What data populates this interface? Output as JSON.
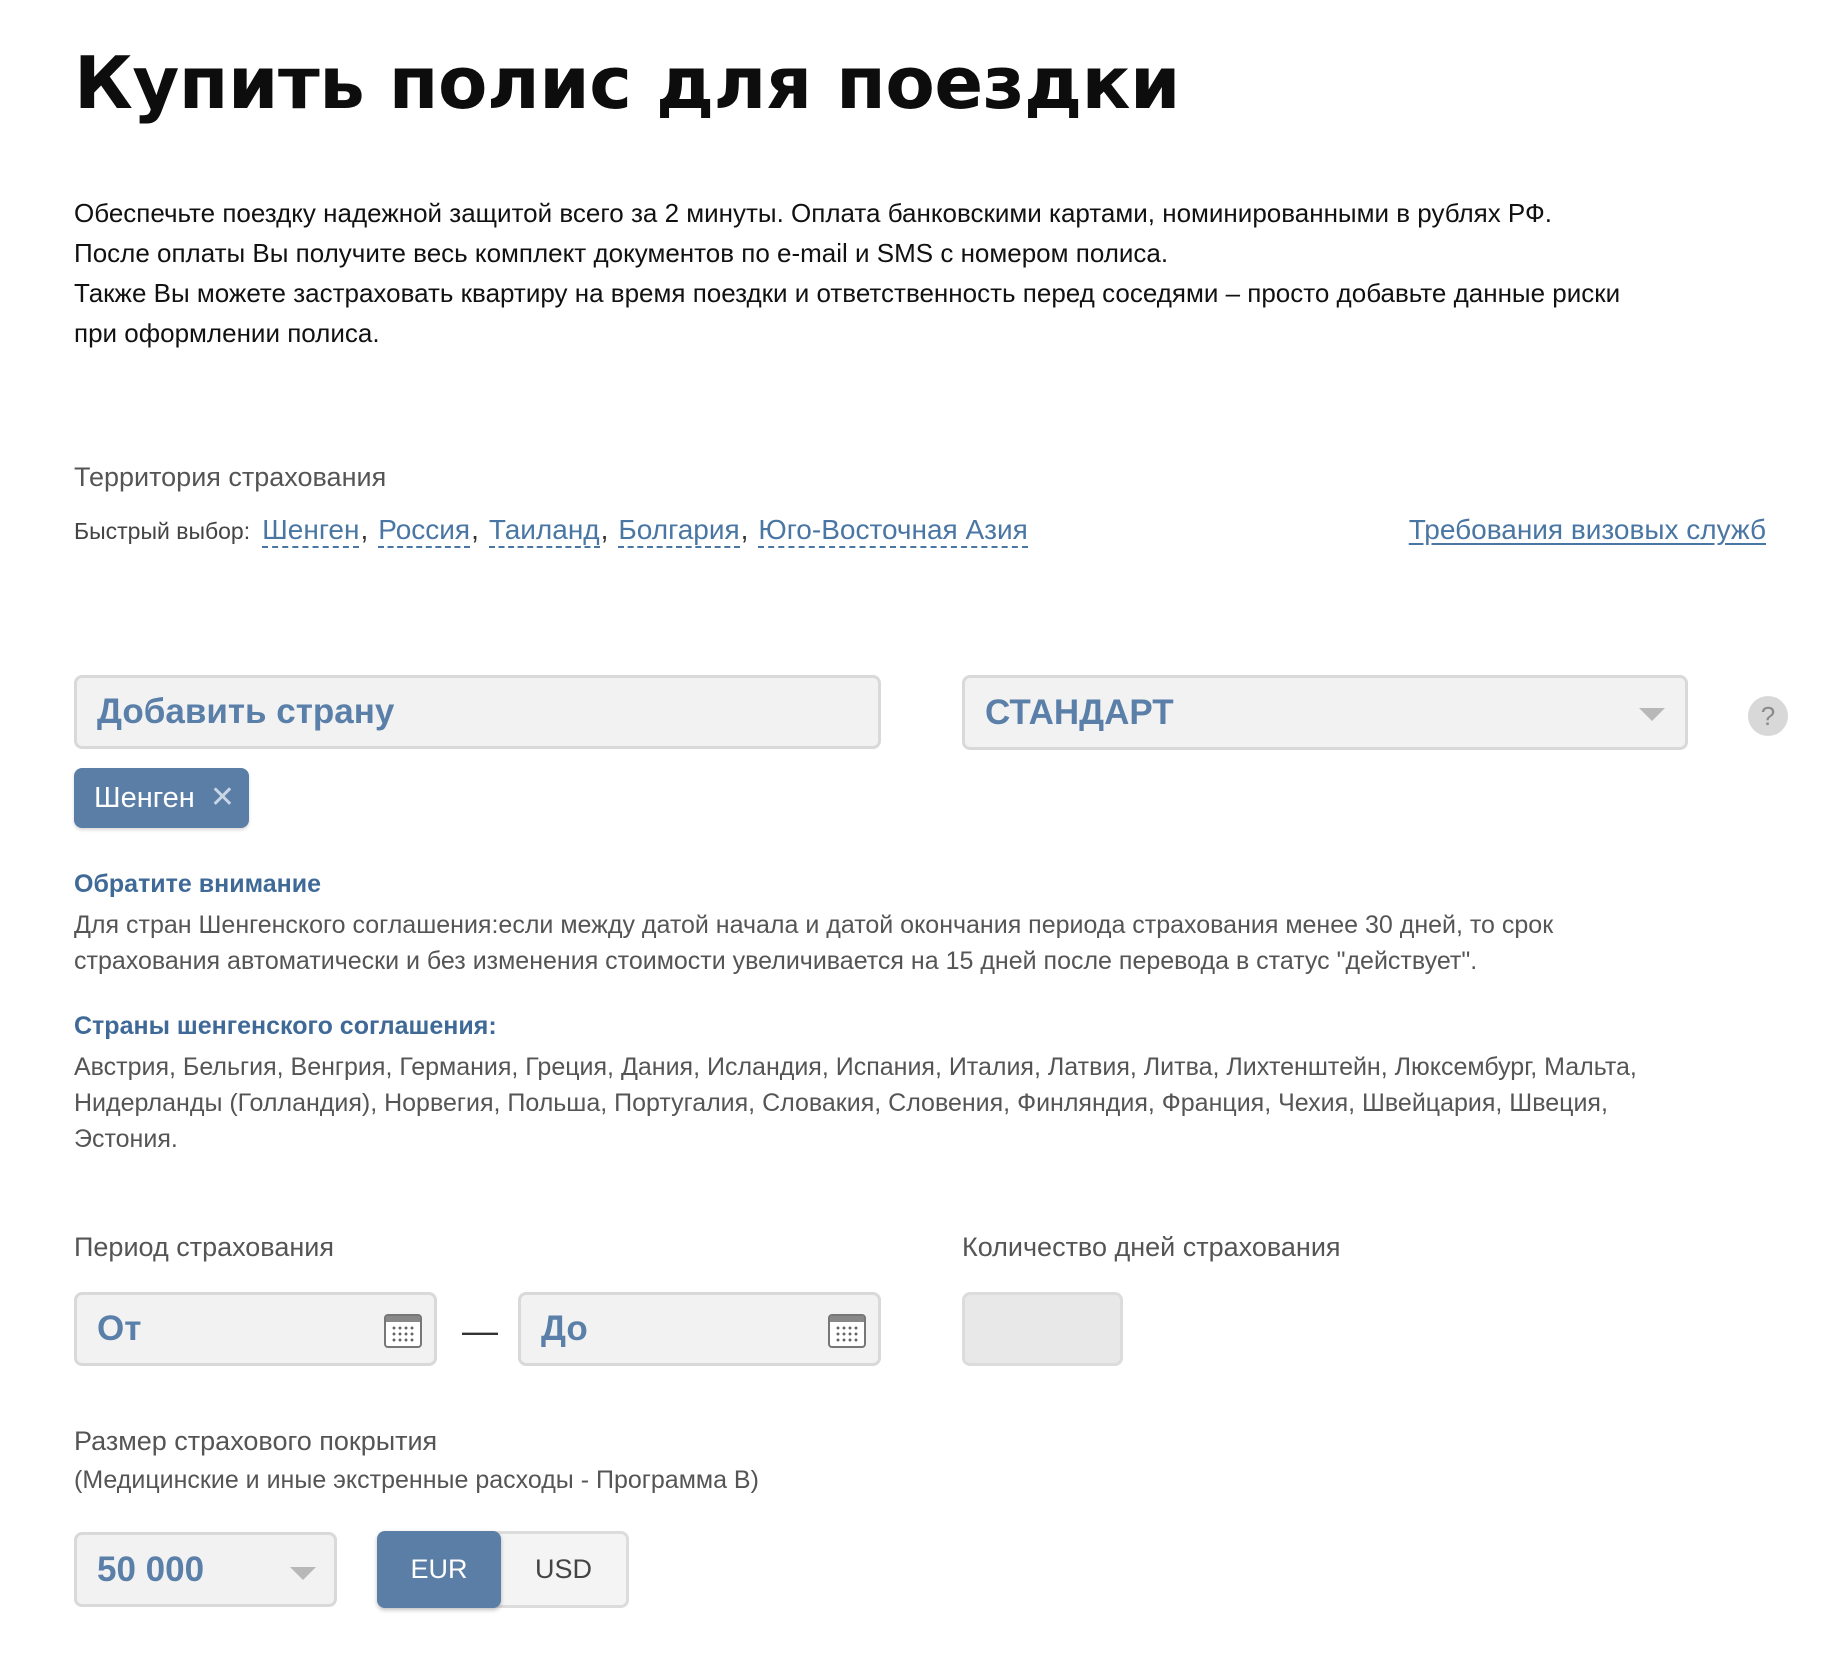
{
  "page_title": "Купить полис для поездки",
  "intro": [
    "Обеспечьте поездку надежной защитой всего за 2 минуты. Оплата банковскими картами, номинированными в рублях РФ.",
    "После оплаты Вы получите весь комплект документов по e-mail и SMS с номером полиса.",
    "Также Вы можете застраховать квартиру на время поездки и ответственность перед соседями – просто добавьте данные риски",
    "при оформлении полиса."
  ],
  "territory": {
    "label": "Территория страхования",
    "quick_label": "Быстрый выбор:",
    "quick_options": [
      "Шенген",
      "Россия",
      "Таиланд",
      "Болгария",
      "Юго-Восточная Азия"
    ],
    "separator": ",",
    "visa_link": "Требования визовых служб",
    "country_placeholder": "Добавить страну",
    "plan_value": "СТАНДАРТ",
    "help_symbol": "?",
    "selected_tag": "Шенген",
    "tag_close": "✕"
  },
  "notice": {
    "title": "Обратите внимание",
    "text": [
      "Для стран Шенгенского соглашения:если между датой начала и датой окончания периода страхования менее 30 дней, то срок",
      "страхования автоматически и без изменения стоимости увеличивается на 15 дней после перевода в статус \"действует\"."
    ],
    "countries_title": "Страны шенгенского соглашения:",
    "countries": [
      "Австрия, Бельгия, Венгрия, Германия, Греция, Дания, Исландия, Испания, Италия, Латвия, Литва, Лихтенштейн, Люксембург, Мальта,",
      "Нидерланды (Голландия), Норвегия, Польша, Португалия, Словакия, Словения, Финляндия, Франция, Чехия, Швейцария, Швеция,",
      "Эстония."
    ]
  },
  "period": {
    "label": "Период страхования",
    "from_placeholder": "От",
    "dash": "—",
    "to_placeholder": "До",
    "days_label": "Количество дней страхования",
    "days_value": ""
  },
  "coverage": {
    "label": "Размер страхового покрытия",
    "sublabel": "(Медицинские и иные экстренные расходы - Программа B)",
    "amount": "50 000",
    "currencies": [
      "EUR",
      "USD"
    ],
    "selected_currency": "EUR"
  },
  "colors": {
    "accent": "#4a76a4",
    "tag_bg": "#5b7ea6",
    "field_bg": "#f2f2f2",
    "field_text": "#5a7fa8"
  }
}
